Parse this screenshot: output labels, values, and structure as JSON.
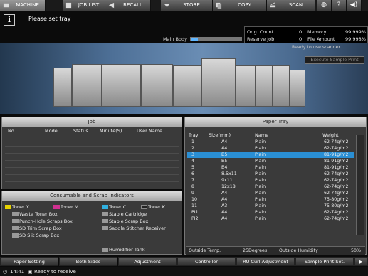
{
  "tabs": [
    {
      "label": "MACHINE",
      "icon": "machine-icon"
    },
    {
      "label": "JOB LIST",
      "icon": "job-list-icon"
    },
    {
      "label": "RECALL",
      "icon": "recall-icon"
    },
    {
      "label": "STORE",
      "icon": "store-icon"
    },
    {
      "label": "COPY",
      "icon": "copy-icon"
    },
    {
      "label": "SCAN",
      "icon": "scan-icon"
    }
  ],
  "top_icons": [
    "globe-icon",
    "help-icon",
    "speaker-icon"
  ],
  "message": {
    "icon": "info-icon",
    "text": "Please set tray"
  },
  "main_body": {
    "label": "Main Body"
  },
  "status_counts": {
    "orig_count_label": "Orig. Count",
    "orig_count": "0",
    "memory_label": "Memory",
    "memory": "99.999%",
    "reserve_job_label": "Reserve Job",
    "reserve_job": "0",
    "file_amount_label": "File Amount",
    "file_amount": "99.998%"
  },
  "scanner_status": "Ready to use scanner",
  "execute_sample_print": "Execute Sample Print",
  "job_panel": {
    "title": "Job",
    "columns": [
      "No.",
      "Mode",
      "Status",
      "Minute(S)",
      "User Name"
    ]
  },
  "consumable_panel": {
    "title": "Consumable and Scrap Indicators",
    "items": [
      {
        "label": "Toner Y",
        "icon": "toner-icon"
      },
      {
        "label": "Toner M",
        "icon": "toner-icon"
      },
      {
        "label": "Toner C",
        "icon": "toner-icon"
      },
      {
        "label": "Toner K",
        "icon": "toner-icon"
      },
      {
        "label": "Waste Toner Box",
        "icon": "waste-toner-icon"
      },
      {
        "label": "Staple Cartridge",
        "icon": "staple-icon"
      },
      {
        "label": "Punch-Hole Scraps Box",
        "icon": "punch-icon"
      },
      {
        "label": "Staple Scrap Box",
        "icon": "staple-icon"
      },
      {
        "label": "SD Trim Scrap Box",
        "icon": "trim-icon"
      },
      {
        "label": "Saddle Stitcher Receiver",
        "icon": "saddle-icon"
      },
      {
        "label": "SD Slit Scrap Box",
        "icon": "slit-icon"
      },
      {
        "label": "Humidifier Tank",
        "icon": "humidifier-icon"
      }
    ]
  },
  "paper_tray": {
    "title": "Paper Tray",
    "columns": [
      "Tray",
      "Size(mm)",
      "Name",
      "Weight"
    ],
    "rows": [
      {
        "tray": "1",
        "size": "A4",
        "name": "Plain",
        "weight": "62-74g/m2",
        "status": "empty"
      },
      {
        "tray": "2",
        "size": "A4",
        "name": "Plain",
        "weight": "62-74g/m2",
        "status": "ok"
      },
      {
        "tray": "3",
        "size": "B5",
        "name": "Plain",
        "weight": "81-91g/m2",
        "status": "ok"
      },
      {
        "tray": "4",
        "size": "B5",
        "name": "Plain",
        "weight": "81-91g/m2",
        "status": "ok"
      },
      {
        "tray": "5",
        "size": "B4",
        "name": "Plain",
        "weight": "81-91g/m2",
        "status": "ok"
      },
      {
        "tray": "6",
        "size": "8.5x11",
        "name": "Plain",
        "weight": "62-74g/m2",
        "status": "ok"
      },
      {
        "tray": "7",
        "size": "9x11",
        "name": "Plain",
        "weight": "62-74g/m2",
        "status": "ok"
      },
      {
        "tray": "8",
        "size": "12x18",
        "name": "Plain",
        "weight": "62-74g/m2",
        "status": "ok"
      },
      {
        "tray": "9",
        "size": "A4",
        "name": "Plain",
        "weight": "62-74g/m2",
        "status": "ok"
      },
      {
        "tray": "10",
        "size": "A4",
        "name": "Plain",
        "weight": "75-80g/m2",
        "status": "ok"
      },
      {
        "tray": "11",
        "size": "A3",
        "name": "Plain",
        "weight": "75-80g/m2",
        "status": "ok"
      },
      {
        "tray": "PI1",
        "size": "A4",
        "name": "Plain",
        "weight": "62-74g/m2",
        "status": "ok"
      },
      {
        "tray": "PI2",
        "size": "A4",
        "name": "Plain",
        "weight": "62-74g/m2",
        "status": "ok"
      }
    ],
    "selected_row": 2,
    "outside_temp_label": "Outside Temp.",
    "outside_temp": "25Degrees",
    "outside_humidity_label": "Outside Humidity",
    "outside_humidity": "50%"
  },
  "bottom_buttons": [
    "Paper Setting",
    "Both Sides",
    "Adjustment",
    "Controller",
    "RU Curl Adjustment",
    "Sample Print Set."
  ],
  "status_bar": {
    "time": "14:41",
    "text": "Ready to receive"
  },
  "colors": {
    "selected_row": "#2a8fd4",
    "header": "#c8c8c8",
    "panel": "#3a3a3a"
  }
}
